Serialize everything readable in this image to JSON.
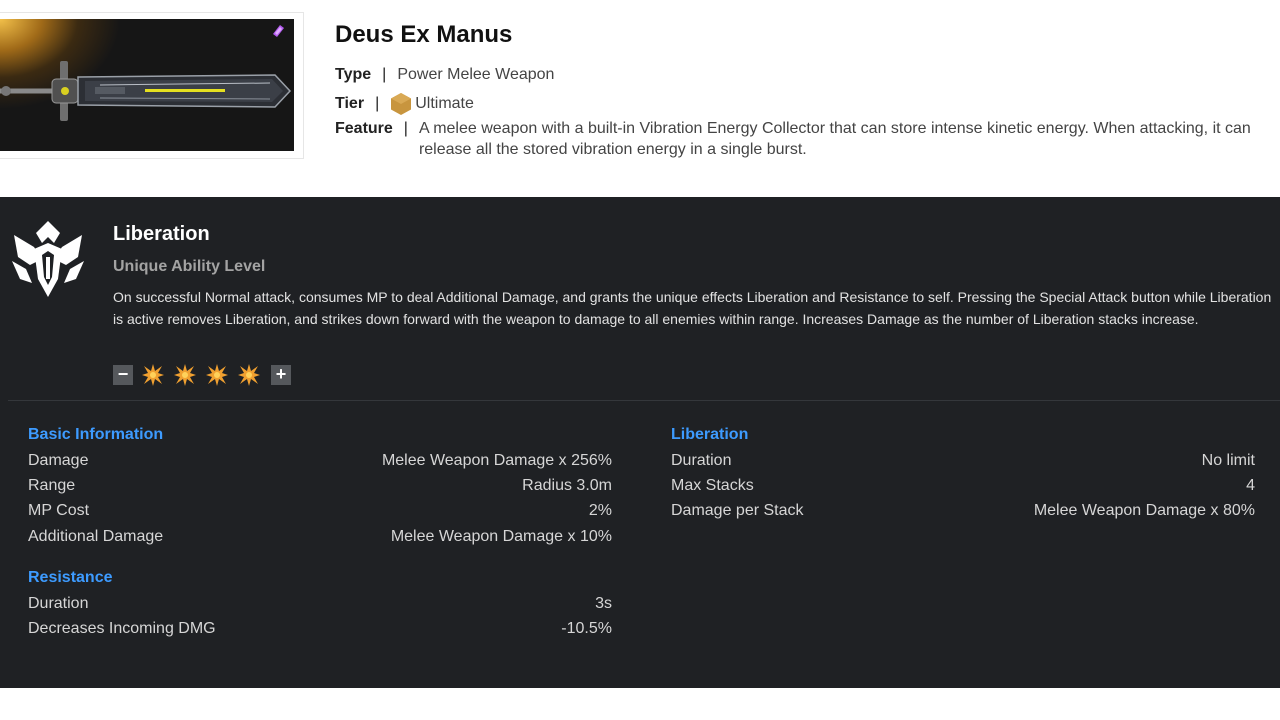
{
  "weapon": {
    "name": "Deus Ex Manus",
    "type_label": "Type",
    "type_value": "Power Melee Weapon",
    "tier_label": "Tier",
    "tier_value": "Ultimate",
    "feature_label": "Feature",
    "feature_value": "A melee weapon with a built-in Vibration Energy Collector that can store intense kinetic energy. When attacking, it can release all the stored vibration energy in a single burst.",
    "separator": "|",
    "badge_icon": "crystal-badge-icon",
    "tier_icon": "hexagon-icon",
    "tier_color": "#c8953e",
    "badge_color": "#b45cf0"
  },
  "ability": {
    "title": "Liberation",
    "subtitle": "Unique Ability Level",
    "description": "On successful Normal attack, consumes MP to deal Additional Damage, and grants the unique effects Liberation and Resistance to self. Pressing the Special Attack button while Liberation is active removes Liberation, and strikes down forward with the weapon to damage to all enemies within range. Increases Damage as the number of Liberation stacks increase.",
    "level": {
      "minus": "−",
      "plus": "+",
      "current": 4,
      "max": 4,
      "star_icon": "burst-star-icon",
      "star_color": "#f0a030"
    }
  },
  "basic_info": {
    "title": "Basic Information",
    "rows": [
      {
        "key": "Damage",
        "value": "Melee Weapon Damage x 256%"
      },
      {
        "key": "Range",
        "value": "Radius 3.0m"
      },
      {
        "key": "MP Cost",
        "value": "2%"
      },
      {
        "key": "Additional Damage",
        "value": "Melee Weapon Damage x 10%"
      }
    ]
  },
  "resistance": {
    "title": "Resistance",
    "rows": [
      {
        "key": "Duration",
        "value": "3s"
      },
      {
        "key": "Decreases Incoming DMG",
        "value": "-10.5%"
      }
    ]
  },
  "liberation": {
    "title": "Liberation",
    "rows": [
      {
        "key": "Duration",
        "value": "No limit"
      },
      {
        "key": "Max Stacks",
        "value": "4"
      },
      {
        "key": "Damage per Stack",
        "value": "Melee Weapon Damage x 80%"
      }
    ]
  },
  "colors": {
    "panel_bg": "#1f2124",
    "section_title": "#3d9bff"
  }
}
